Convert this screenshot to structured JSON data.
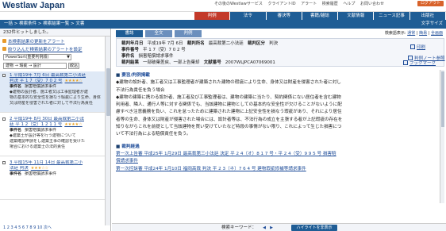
{
  "header": {
    "logo": "Westlaw Japan",
    "utilities": [
      "その後のWestlawサービス",
      "クライアントID",
      "アラート",
      "検索履歴",
      "ヘルプ",
      "お問い合わせ"
    ],
    "logout": "ログアウト"
  },
  "nav_tabs": [
    {
      "label": "判例",
      "active": true
    },
    {
      "label": "法令",
      "active": false
    },
    {
      "label": "審決等",
      "active": false
    },
    {
      "label": "書籍/雑誌",
      "active": false
    },
    {
      "label": "文献情報",
      "active": false
    },
    {
      "label": "ニュース記事",
      "active": false
    },
    {
      "label": "出版社",
      "active": false
    }
  ],
  "breadcrumb": "一括 > 検索条件 > 検索結果一覧 > 文書",
  "font_size_label": "文字サイズ",
  "left": {
    "hits": "232件ヒットしました。",
    "link_alert": "本検索結果の更新をアラート",
    "link_filter": "絞り込んだ検索結果のアラートを設定",
    "sort_value": "PowerSort(重要判例順)",
    "filter_placeholder": "建物 → 瑕疵 → 設計",
    "filter_button": "絞込",
    "results": [
      {
        "title": "1 平成19年 7月 6日 最高裁第二小法廷",
        "title2": "判決 平 1 7（受）7 0 2 号",
        "stars": "★★★★☆",
        "label": "事件名",
        "name": "損害賠償請求事件",
        "summary": [
          "◆建物の設計者、施工者又は工事監理者が建",
          "物の基本的な安全性を損なう瑕疵により生命、身体",
          "又は財産を侵害された者に対して不法行為責任"
        ]
      },
      {
        "title": "2 平成19年 8月 30日 最高裁第二小法",
        "title2": "廷 平 1 2（受）1 2 1 1 号",
        "stars": "★★★★☆",
        "label": "事件名",
        "name": "損害賠償請求事件",
        "summary": [
          "◆建築士が設計等を行う建物について",
          "建築確認申請をし建築主事の確認を受けた",
          "場合における建築士の法的責任"
        ]
      },
      {
        "title": "3 平成15年 11月 14日 最高裁第二小",
        "title2": "法廷 判決",
        "stars": "★★★☆☆",
        "label": "事件名",
        "name": "損害賠償請求事件",
        "summary": []
      }
    ],
    "pager": "1 2 3 4 5 6 7 8 9 10 次へ"
  },
  "doc_tabs": [
    {
      "label": "書誌",
      "active": true
    },
    {
      "label": "全文",
      "active": false
    },
    {
      "label": "判例",
      "active": false
    }
  ],
  "view_links": {
    "prefix": "検索語表示:",
    "normal": "通常",
    "plain": "簡易",
    "full": "全画面"
  },
  "info": {
    "date_label": "裁判年月日",
    "date": "平成19年 7月 6日",
    "court_label": "裁判所名",
    "court": "最高裁第二小法廷",
    "type_label": "裁判区分",
    "type": "判決",
    "case_no_label": "事件番号",
    "case_no": "平 1 7（受）7 0 2 号",
    "case_name_label": "事件名",
    "case_name": "損害賠償請求事件",
    "result_label": "裁判結果",
    "result": "一部破棄差戻、一部上告棄却",
    "doc_no_label": "文献番号",
    "doc_no": "2007WLJPCA07069001",
    "print": "印刷",
    "note": "判例ノート参照",
    "bookmark": "ブックマーク"
  },
  "body": {
    "sec1": "要旨/判例掲載",
    "p1": [
      "◆建物の設計者、施工者又は工事監理者が建築された建物の瑕疵により生命、身体又は財産を侵害された者に対し",
      "不法行為責任を負う場合",
      "◆建物の建築に携わる設計者、施工者及び工事監理者は、建物の建築に当たり、契約関係にない居住者を含む建物",
      "利用者、隣人、通行人等に対する関係でも、当該建物に建物としての基本的な安全性が欠けることがないように配",
      "慮すべき注意義務を負い、これを怠ったために建築された建物に上記安全性を損なう瑕疵があり、それにより居住",
      "者等の生命、身体又は財産が侵害された場合には、設計者等は、不法行為の成立を主張する者が上記瑕疵の存在を",
      "知りながらこれを前提として当該建物を買い受けていたなど特段の事情がない限り、これによって生じた損害につ",
      "いて不法行為による賠償責任を負う。"
    ],
    "sec2": "裁判経過",
    "p2": [
      "第一次上告審 平成25年 1月29日 最高裁第三小法廷 決定 平 2 4（オ）8 1 7 号・平 2 4（受）9 9 5 号 損害賠",
      "償請求事件",
      "第一次控訴審 平成24年 1月10日 福岡高裁 判決 平 2 3（ネ）7 6 4 号 建物瑕疵修補等請求事件"
    ]
  },
  "footer": {
    "keyword_label": "検索キーワード：",
    "prev": "◀",
    "next": "▶",
    "highlight": "ハイライトを非表示"
  }
}
